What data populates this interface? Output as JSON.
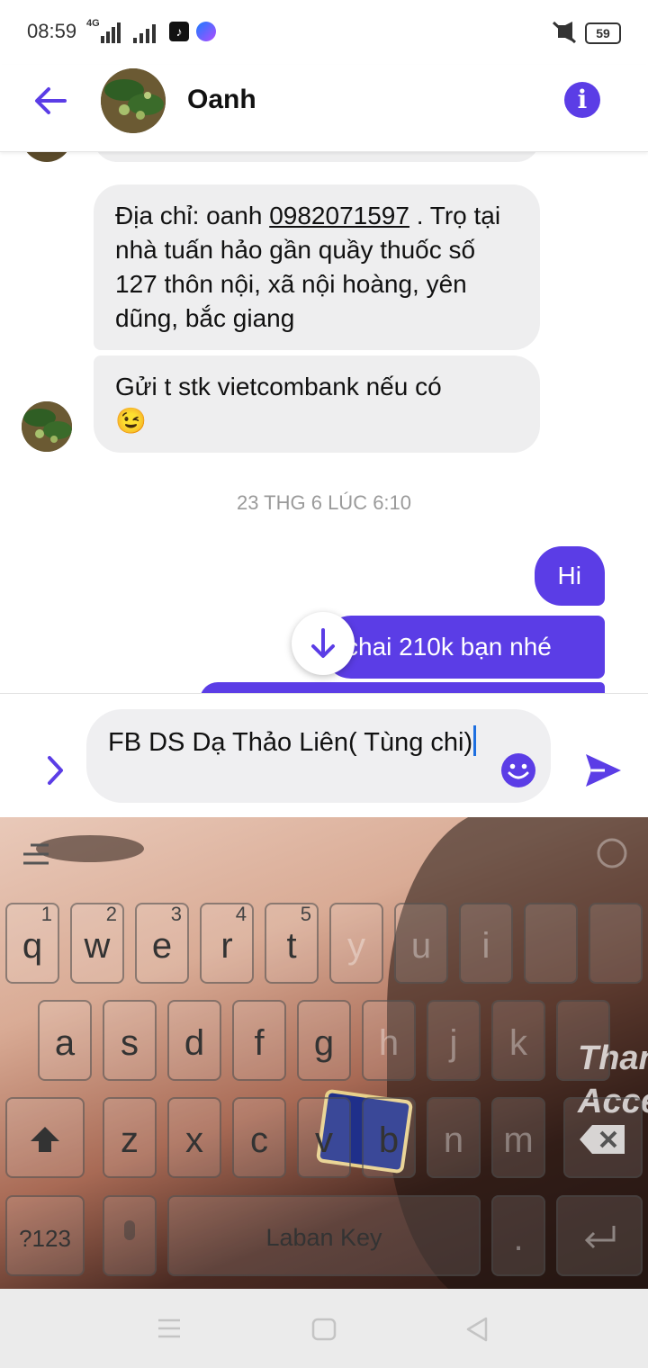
{
  "status_bar": {
    "time": "08:59",
    "network": "4G",
    "battery": "59",
    "icons": [
      "tiktok-icon",
      "messenger-icon",
      "mute-icon",
      "battery-icon"
    ]
  },
  "header": {
    "contact_name": "Oanh",
    "back_icon": "arrow-left-icon",
    "info_icon": "info-icon",
    "info_label": "i"
  },
  "messages": {
    "incoming": [
      {
        "text_before_link": "Địa chỉ: oanh ",
        "phone": "0982071597",
        "text_after_link": " . Trọ tại nhà tuấn hảo gần quầy thuốc số 127 thôn nội, xã nội hoàng, yên dũng, bắc giang"
      },
      {
        "text": "Gửi t stk vietcombank nếu có",
        "emoji": "😉"
      }
    ],
    "timestamp": "23 THG 6 LÚC 6:10",
    "outgoing": [
      {
        "text": "Hi"
      },
      {
        "text": "chai 210k bạn nhé"
      }
    ]
  },
  "composer": {
    "text": "FB DS Dạ Thảo Liên( Tùng chi)",
    "expand_icon": "chevron-right-icon",
    "emoji_icon": "smiley-icon",
    "send_icon": "send-icon"
  },
  "keyboard": {
    "row1": [
      {
        "key": "q",
        "num": "1"
      },
      {
        "key": "w",
        "num": "2"
      },
      {
        "key": "e",
        "num": "3"
      },
      {
        "key": "r",
        "num": "4"
      },
      {
        "key": "t",
        "num": "5"
      },
      {
        "key": "y",
        "num": ""
      },
      {
        "key": "u",
        "num": ""
      },
      {
        "key": "i",
        "num": ""
      },
      {
        "key": "",
        "num": ""
      },
      {
        "key": "",
        "num": ""
      }
    ],
    "row2": [
      "a",
      "s",
      "d",
      "f",
      "g",
      "h",
      "j",
      "k",
      ""
    ],
    "row3": [
      "z",
      "x",
      "c",
      "v",
      "b",
      "n",
      "m"
    ],
    "symbols_key": "?123",
    "space_label": "Laban Key",
    "period_key": ".",
    "overlay_text": [
      "Than",
      "Acce"
    ]
  },
  "colors": {
    "accent": "#5b3de6",
    "incoming_bubble": "#eeeeef"
  }
}
